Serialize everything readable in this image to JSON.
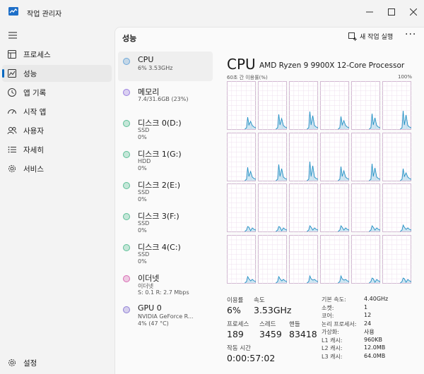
{
  "window": {
    "title": "작업 관리자"
  },
  "nav": {
    "items": [
      {
        "id": "processes",
        "label": "프로세스"
      },
      {
        "id": "performance",
        "label": "성능"
      },
      {
        "id": "app-history",
        "label": "앱 기록"
      },
      {
        "id": "startup",
        "label": "시작 앱"
      },
      {
        "id": "users",
        "label": "사용자"
      },
      {
        "id": "details",
        "label": "자세히"
      },
      {
        "id": "services",
        "label": "서비스"
      }
    ],
    "settings_label": "설정"
  },
  "header": {
    "title": "성능",
    "run_task": "새 작업 실행",
    "more": "···"
  },
  "devices": [
    {
      "name": "CPU",
      "sub1": "6% 3.53GHz",
      "sub2": "",
      "color": "#6ea8d9"
    },
    {
      "name": "메모리",
      "sub1": "7.4/31.6GB (23%)",
      "sub2": "",
      "color": "#9b7fe0"
    },
    {
      "name": "디스크 0(D:)",
      "sub1": "SSD",
      "sub2": "0%",
      "color": "#5cbf97"
    },
    {
      "name": "디스크 1(G:)",
      "sub1": "HDD",
      "sub2": "0%",
      "color": "#5cbf97"
    },
    {
      "name": "디스크 2(E:)",
      "sub1": "SSD",
      "sub2": "0%",
      "color": "#5cbf97"
    },
    {
      "name": "디스크 3(F:)",
      "sub1": "SSD",
      "sub2": "0%",
      "color": "#5cbf97"
    },
    {
      "name": "디스크 4(C:)",
      "sub1": "SSD",
      "sub2": "0%",
      "color": "#5cbf97"
    },
    {
      "name": "이더넷",
      "sub1": "이더넷",
      "sub2": "S: 0.1 R: 2.7 Mbps",
      "color": "#d96bb3"
    },
    {
      "name": "GPU 0",
      "sub1": "NVIDIA GeForce R...",
      "sub2": "4% (47 °C)",
      "color": "#8f7fd6"
    }
  ],
  "detail": {
    "title": "CPU",
    "model": "AMD Ryzen 9 9900X 12-Core Processor",
    "axis_left": "60초 간 이용률(%)",
    "axis_right": "100%",
    "stats": {
      "util_label": "이용률",
      "util_value": "6%",
      "speed_label": "속도",
      "speed_value": "3.53GHz",
      "proc_label": "프로세스",
      "proc_value": "189",
      "thread_label": "스레드",
      "thread_value": "3459",
      "handle_label": "핸들",
      "handle_value": "83418",
      "uptime_label": "작동 시간",
      "uptime_value": "0:00:57:02"
    },
    "specs": [
      {
        "label": "기본 속도:",
        "value": "4.40GHz"
      },
      {
        "label": "소켓:",
        "value": "1"
      },
      {
        "label": "코어:",
        "value": "12"
      },
      {
        "label": "논리 프로세서:",
        "value": "24"
      },
      {
        "label": "가상화:",
        "value": "사용"
      },
      {
        "label": "L1 캐시:",
        "value": "960KB"
      },
      {
        "label": "L2 캐시:",
        "value": "12.0MB"
      },
      {
        "label": "L3 캐시:",
        "value": "64.0MB"
      }
    ],
    "graph_color": "#1f8fc4"
  }
}
